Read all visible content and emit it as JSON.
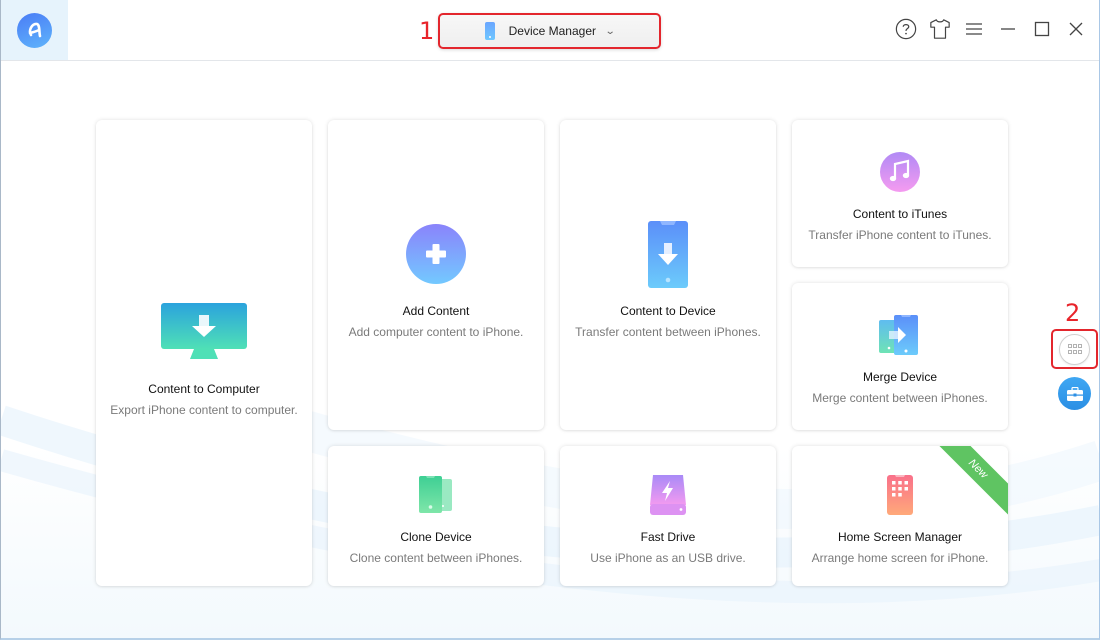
{
  "app": {
    "logo_letter": "a",
    "title": "Device Manager"
  },
  "annotations": {
    "step1": "1",
    "step2": "2"
  },
  "titlebar": {
    "dropdown_label": "Device Manager",
    "actions": [
      {
        "name": "help",
        "icon": "question-icon"
      },
      {
        "name": "skin",
        "icon": "tshirt-icon"
      },
      {
        "name": "menu",
        "icon": "hamburger-icon"
      },
      {
        "name": "minimize",
        "icon": "minimize-icon"
      },
      {
        "name": "maximize",
        "icon": "maximize-icon"
      },
      {
        "name": "close",
        "icon": "close-icon"
      }
    ]
  },
  "cards": {
    "content_to_computer": {
      "title": "Content to Computer",
      "desc": "Export iPhone content to computer."
    },
    "add_content": {
      "title": "Add Content",
      "desc": "Add computer content to iPhone."
    },
    "content_to_device": {
      "title": "Content to Device",
      "desc": "Transfer content between iPhones."
    },
    "content_to_itunes": {
      "title": "Content to iTunes",
      "desc": "Transfer iPhone content to iTunes."
    },
    "merge_device": {
      "title": "Merge Device",
      "desc": "Merge content between iPhones."
    },
    "clone_device": {
      "title": "Clone Device",
      "desc": "Clone content between iPhones."
    },
    "fast_drive": {
      "title": "Fast Drive",
      "desc": "Use iPhone as an USB drive."
    },
    "home_screen_manager": {
      "title": "Home Screen Manager",
      "desc": "Arrange home screen for iPhone.",
      "badge": "New"
    }
  },
  "side": {
    "grid_button": "more-tools",
    "toolbox_button": "toolbox"
  },
  "colors": {
    "accent_blue": "#4a7cf6",
    "annotation_red": "#e3262d",
    "new_badge_green": "#5fc462"
  }
}
